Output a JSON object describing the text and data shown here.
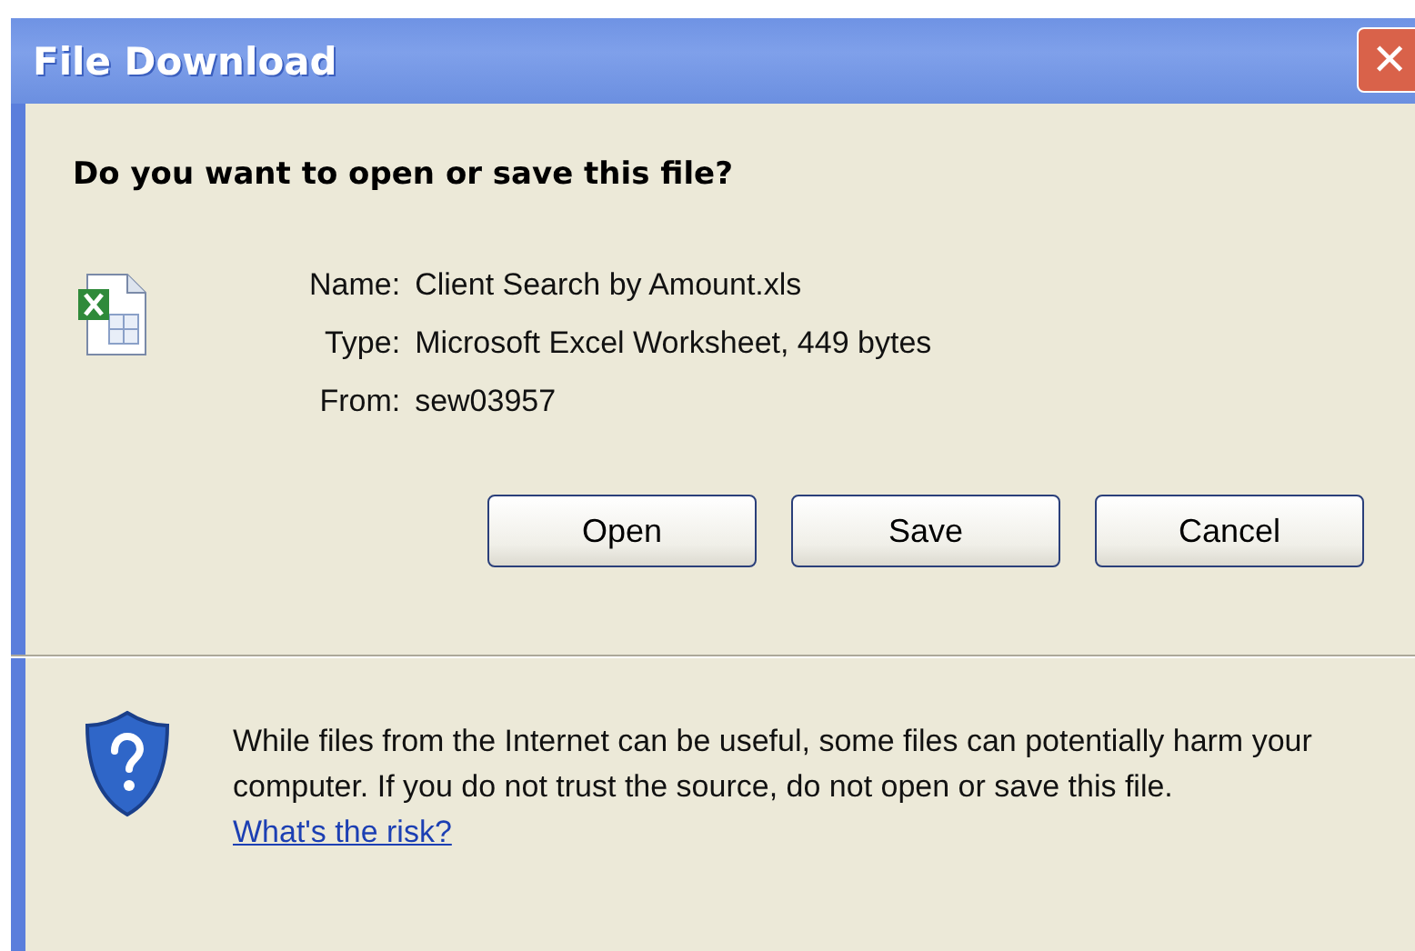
{
  "window": {
    "title": "File Download",
    "close_glyph": "✕"
  },
  "question": "Do you want to open or save this file?",
  "file_info": [
    {
      "label": "Name:",
      "value": "Client Search by Amount.xls"
    },
    {
      "label": "Type:",
      "value": "Microsoft Excel Worksheet, 449 bytes"
    },
    {
      "label": "From:",
      "value": "sew03957"
    }
  ],
  "buttons": [
    "Open",
    "Save",
    "Cancel"
  ],
  "warning": {
    "text": "While files from the Internet can be useful, some files can potentially harm your computer. If you do not trust the source, do not open or save this file.",
    "link": "What's the risk?"
  }
}
